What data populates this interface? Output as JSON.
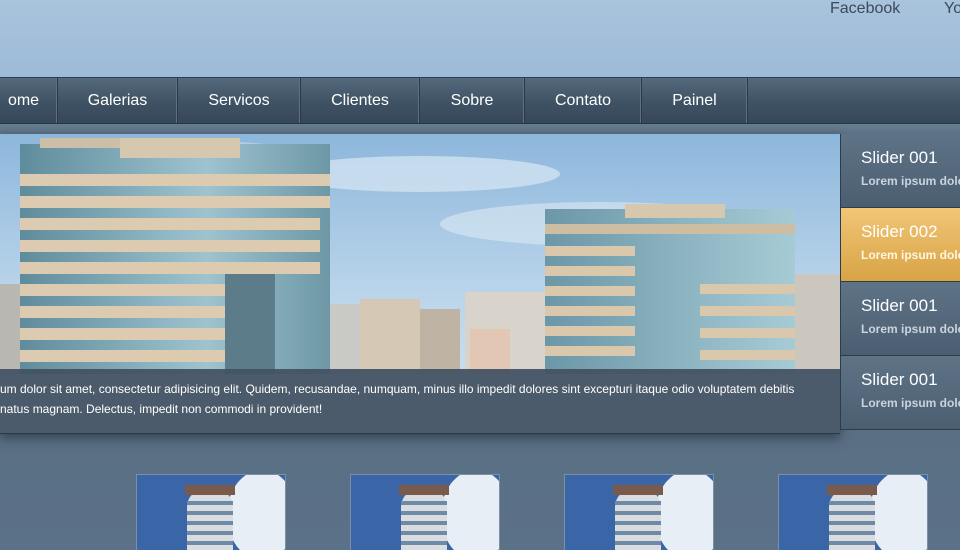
{
  "social": {
    "facebook": "Facebook",
    "youtube": "Yo"
  },
  "nav": {
    "items": [
      {
        "label": "ome"
      },
      {
        "label": "Galerias"
      },
      {
        "label": "Servicos"
      },
      {
        "label": "Clientes"
      },
      {
        "label": "Sobre"
      },
      {
        "label": "Contato"
      },
      {
        "label": "Painel"
      }
    ]
  },
  "hero": {
    "caption_line1": "um dolor sit amet, consectetur adipisicing elit. Quidem, recusandae, numquam, minus illo impedit dolores sint excepturi itaque odio voluptatem debitis",
    "caption_line2": "natus magnam. Delectus, impedit non commodi in provident!"
  },
  "slider": {
    "tabs": [
      {
        "title": "Slider 001",
        "subtitle": "Lorem ipsum dolo",
        "active": false
      },
      {
        "title": "Slider 002",
        "subtitle": "Lorem ipsum dolo",
        "active": true
      },
      {
        "title": "Slider 001",
        "subtitle": "Lorem ipsum dolo",
        "active": false
      },
      {
        "title": "Slider 001",
        "subtitle": "Lorem ipsum dolo",
        "active": false
      }
    ],
    "active_color": "#e0b158"
  },
  "thumbnails": [
    {
      "icon": "building-thumbnail"
    },
    {
      "icon": "building-thumbnail"
    },
    {
      "icon": "building-thumbnail"
    },
    {
      "icon": "building-thumbnail"
    }
  ]
}
